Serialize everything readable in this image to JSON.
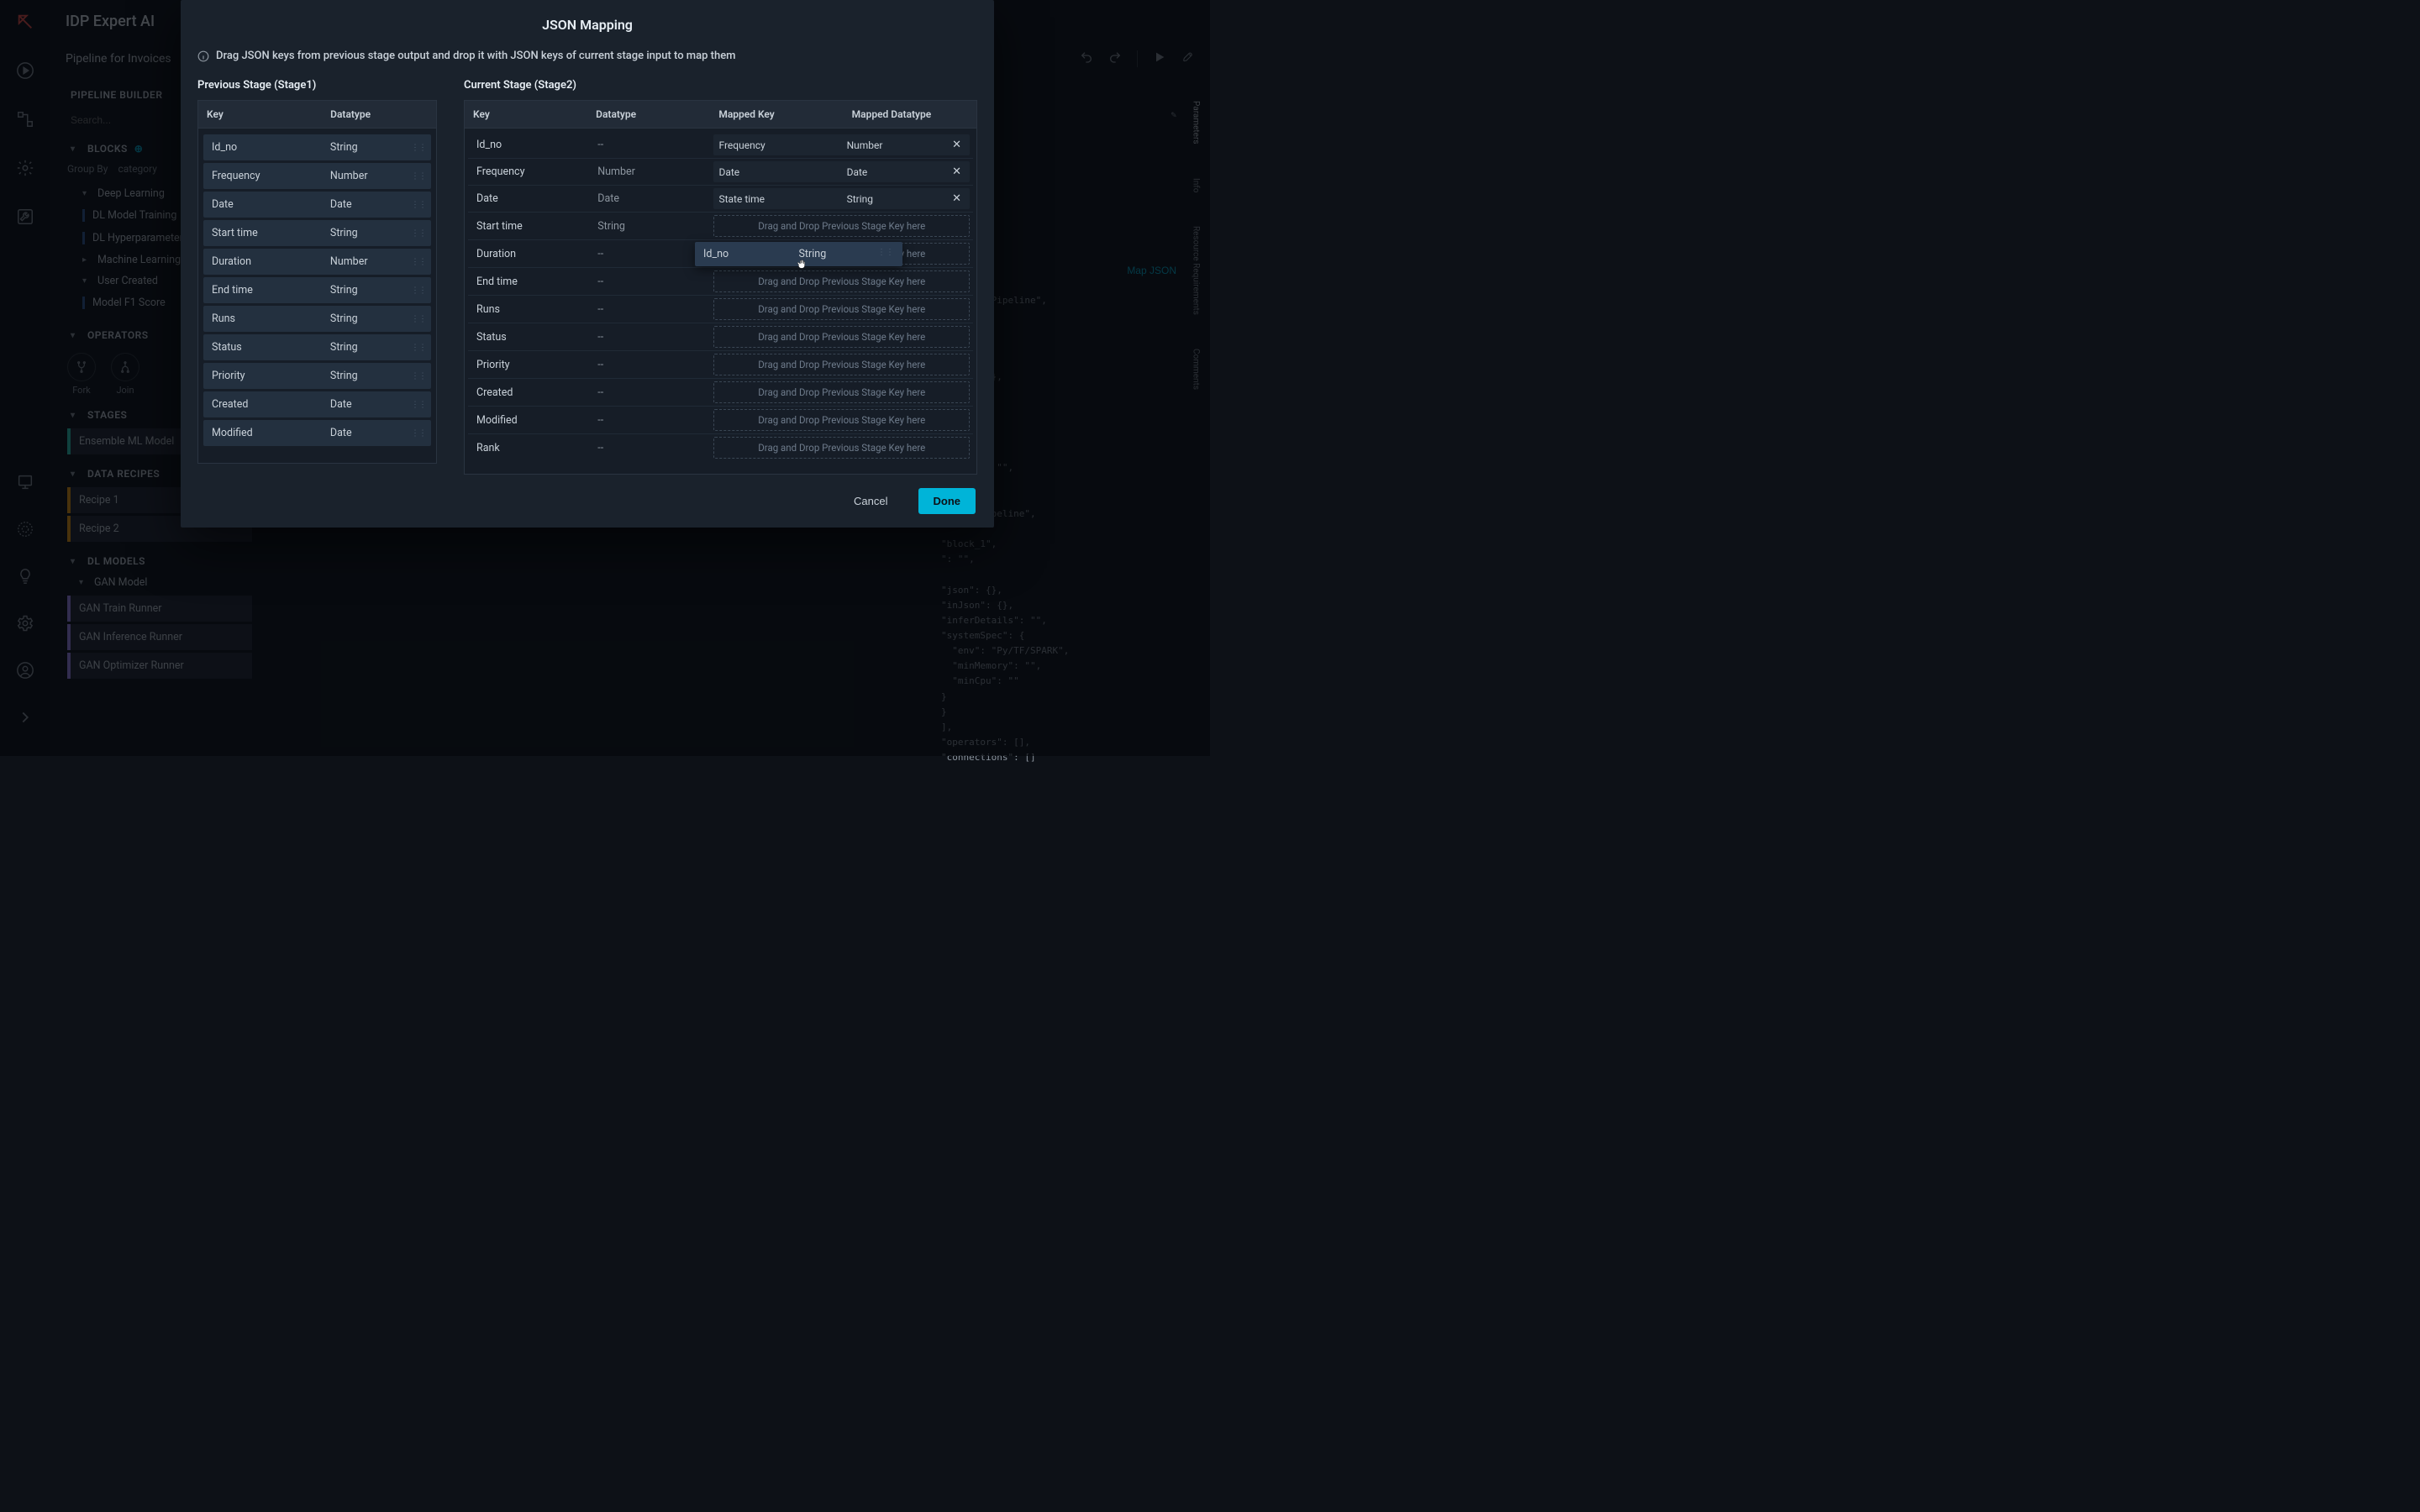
{
  "app": {
    "title": "IDP Expert AI"
  },
  "pipeline": {
    "subtitle": "Pipeline for Invoices"
  },
  "builder": {
    "title": "PIPELINE BUILDER",
    "search_placeholder": "Search...",
    "blocks_title": "BLOCKS",
    "group_by_label": "Group By",
    "group_by_value": "category",
    "deep_learning": "Deep Learning",
    "dl_children": [
      "DL Model Training",
      "DL Hyperparameter"
    ],
    "machine_learning": "Machine Learning",
    "user_created": "User Created",
    "uc_children": [
      "Model F1 Score"
    ],
    "operators_title": "OPERATORS",
    "op_fork": "Fork",
    "op_join": "Join",
    "stages_title": "STAGES",
    "stages": [
      "Ensemble ML Model"
    ],
    "recipes_title": "DATA RECIPES",
    "recipes": [
      "Recipe 1",
      "Recipe 2"
    ],
    "dlmodels_title": "DL MODELS",
    "gan_model": "GAN Model",
    "gan_children": [
      "GAN Train Runner",
      "GAN Inference Runner",
      "GAN Optimizer Runner"
    ]
  },
  "right": {
    "map_json_label": "Map JSON",
    "code": "        \"Pipeline\",\n\n\n\n\n\"json\": {},\n\n\n\n\n\n\"memory\": \"\",\n\n\n Block Pipeline\",\n\n\"block_1\",\n\": \"\",\n\n\"json\": {},\n\"inJson\": {},\n\"inferDetails\": \"\",\n\"systemSpec\": {\n  \"env\": \"Py/TF/SPARK\",\n  \"minMemory\": \"\",\n  \"minCpu\": \"\"\n}\n}\n],\n\"operators\": [],\n\"connections\": []",
    "tabs": [
      "Parameters",
      "Info",
      "Resource Requirements",
      "Comments"
    ]
  },
  "modal": {
    "title": "JSON Mapping",
    "hint": "Drag JSON keys from previous stage output and drop it with JSON keys of current stage input to map them",
    "prev_title": "Previous Stage (Stage1)",
    "cur_title": "Current Stage (Stage2)",
    "head_key": "Key",
    "head_dt": "Datatype",
    "head_mk": "Mapped Key",
    "head_mdt": "Mapped Datatype",
    "drop_placeholder": "Drag and Drop Previous Stage Key here",
    "dash": "--",
    "prev_rows": [
      {
        "key": "Id_no",
        "dt": "String"
      },
      {
        "key": "Frequency",
        "dt": "Number"
      },
      {
        "key": "Date",
        "dt": "Date"
      },
      {
        "key": "Start time",
        "dt": "String"
      },
      {
        "key": "Duration",
        "dt": "Number"
      },
      {
        "key": "End time",
        "dt": "String"
      },
      {
        "key": "Runs",
        "dt": "String"
      },
      {
        "key": "Status",
        "dt": "String"
      },
      {
        "key": "Priority",
        "dt": "String"
      },
      {
        "key": "Created",
        "dt": "Date"
      },
      {
        "key": "Modified",
        "dt": "Date"
      }
    ],
    "cur_rows": [
      {
        "key": "Id_no",
        "dt": "--",
        "mapped": {
          "mk": "Frequency",
          "mdt": "Number"
        }
      },
      {
        "key": "Frequency",
        "dt": "Number",
        "mapped": {
          "mk": "Date",
          "mdt": "Date"
        }
      },
      {
        "key": "Date",
        "dt": "Date",
        "mapped": {
          "mk": "State time",
          "mdt": "String"
        }
      },
      {
        "key": "Start time",
        "dt": "String",
        "mapped": null
      },
      {
        "key": "Duration",
        "dt": "--",
        "mapped": null
      },
      {
        "key": "End time",
        "dt": "--",
        "mapped": null
      },
      {
        "key": "Runs",
        "dt": "--",
        "mapped": null
      },
      {
        "key": "Status",
        "dt": "--",
        "mapped": null
      },
      {
        "key": "Priority",
        "dt": "--",
        "mapped": null
      },
      {
        "key": "Created",
        "dt": "--",
        "mapped": null
      },
      {
        "key": "Modified",
        "dt": "--",
        "mapped": null
      },
      {
        "key": "Rank",
        "dt": "--",
        "mapped": null
      }
    ],
    "drag_chip": {
      "key": "Id_no",
      "dt": "String"
    },
    "btn_cancel": "Cancel",
    "btn_done": "Done"
  }
}
